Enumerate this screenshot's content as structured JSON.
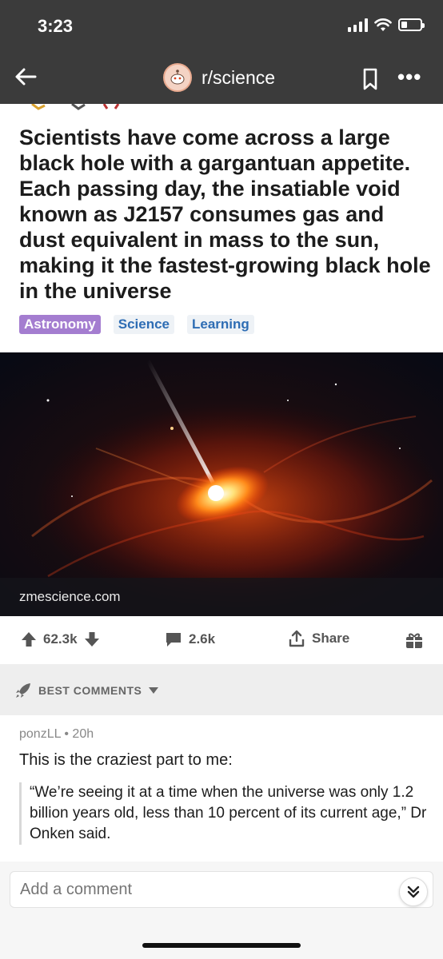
{
  "status_bar": {
    "time": "3:23",
    "battery_level": 0.3
  },
  "header": {
    "subreddit": "r/science",
    "back_icon": "back-arrow-icon",
    "bookmark_icon": "bookmark-icon",
    "more_icon": "more-icon",
    "more_label": "•••"
  },
  "post": {
    "title": "Scientists have come across a large black hole with a gargantuan appetite. Each passing day, the insatiable void known as J2157 consumes gas and dust equivalent in mass to the sun, making it the fastest-growing black hole in the universe",
    "flairs": [
      {
        "label": "Astronomy",
        "color": "#a47dd0"
      },
      {
        "label": "Science"
      },
      {
        "label": "Learning"
      }
    ],
    "link_domain": "zmescience.com"
  },
  "actions": {
    "upvotes": "62.3k",
    "comments": "2.6k",
    "share_label": "Share"
  },
  "sort": {
    "label": "BEST COMMENTS"
  },
  "comment": {
    "author": "ponzLL",
    "age": "20h",
    "separator": "•",
    "body": "This is the craziest part to me:",
    "quote": "“We’re seeing it at a time when the universe was only 1.2 billion years old, less than 10 percent of its current age,” Dr Onken said."
  },
  "composer": {
    "placeholder": "Add a comment"
  },
  "colors": {
    "header_bg": "#3b3b3b",
    "flair_link": "#2e6db4",
    "astronomy_flair": "#a47dd0"
  }
}
